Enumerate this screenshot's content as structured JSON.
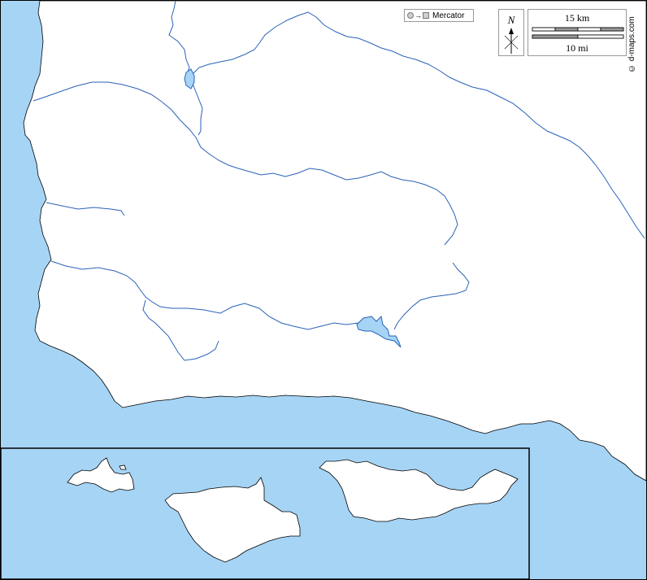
{
  "map": {
    "projection_label": "Mercator",
    "north_label": "N",
    "scale_km_label": "15 km",
    "scale_mi_label": "10 mi",
    "credit": "© d-maps.com",
    "colors": {
      "sea": "#a6d4f5",
      "land": "#ffffff",
      "river": "#2a62b8",
      "coast": "#000000",
      "border": "#000000"
    },
    "icons": [
      "projection-icon",
      "compass-icon"
    ]
  }
}
